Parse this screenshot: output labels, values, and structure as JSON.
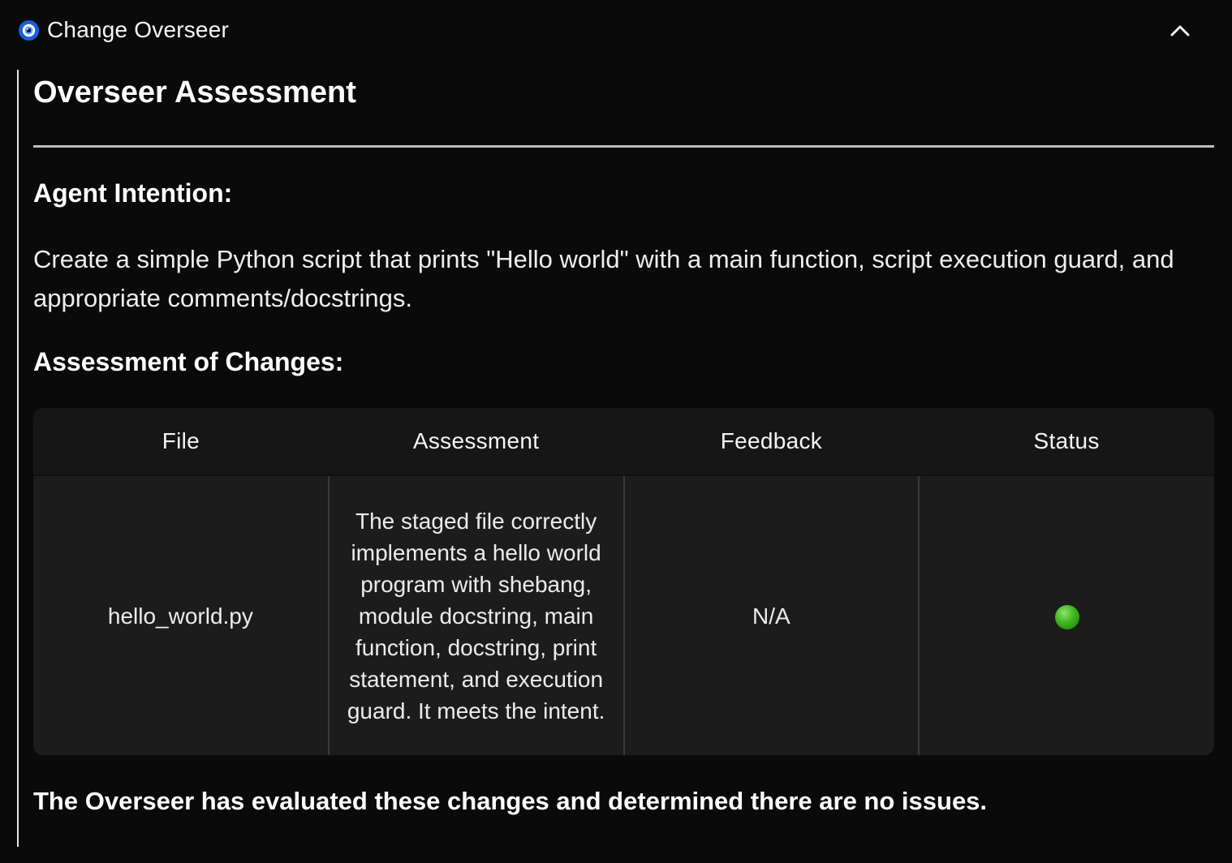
{
  "header": {
    "title": "Change Overseer",
    "icon": "nazar-eye-icon",
    "collapse_icon": "chevron-up-icon"
  },
  "assessment": {
    "title": "Overseer Assessment",
    "intention_heading": "Agent Intention:",
    "intention_text": "Create a simple Python script that prints \"Hello world\" with a main function, script execution guard, and appropriate comments/docstrings.",
    "changes_heading": "Assessment of Changes:",
    "table": {
      "columns": [
        "File",
        "Assessment",
        "Feedback",
        "Status"
      ],
      "rows": [
        {
          "file": "hello_world.py",
          "assessment": "The staged file correctly implements a hello world program with shebang, module docstring, main function, docstring, print statement, and execution guard. It meets the intent.",
          "feedback": "N/A",
          "status": "green-circle-icon",
          "status_color": "#3fb51d"
        }
      ]
    },
    "conclusion": "The Overseer has evaluated these changes and determined there are no issues."
  },
  "colors": {
    "background": "#0a0a0a",
    "table_background": "#1c1c1c",
    "eye_blue": "#1a5fd8",
    "status_green": "#3fb51d"
  }
}
